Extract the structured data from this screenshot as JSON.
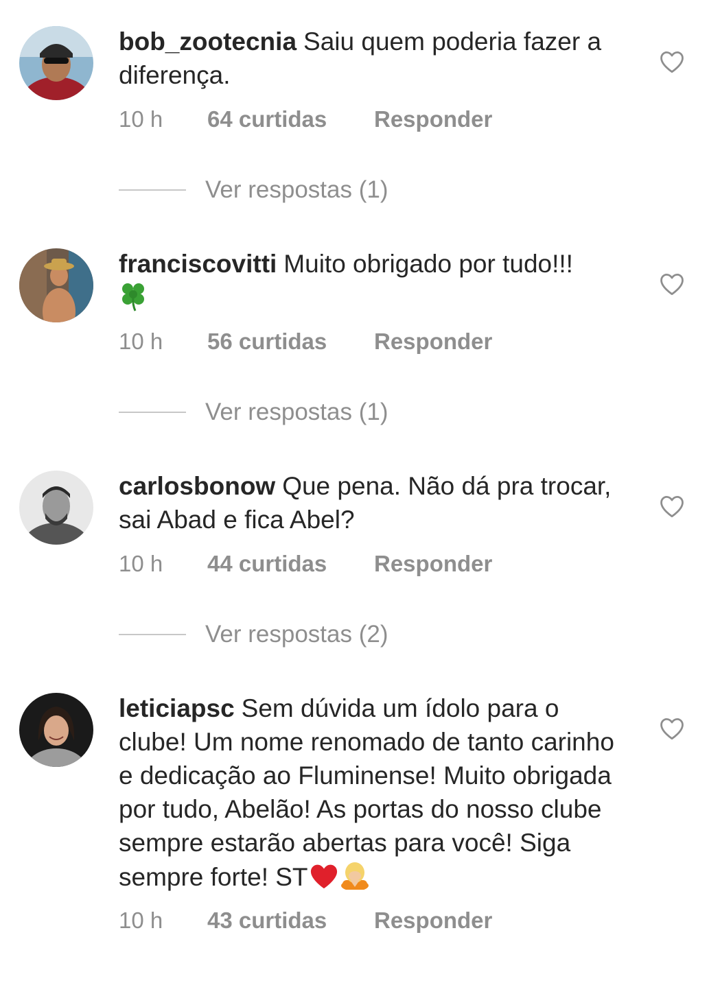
{
  "comments": [
    {
      "username": "bob_zootecnia",
      "text": "Saiu quem poderia fazer a diferença.",
      "time": "10 h",
      "likes": "64 curtidas",
      "reply": "Responder",
      "view_replies": "Ver respostas (1)"
    },
    {
      "username": "franciscovitti",
      "text": "Muito obrigado por tudo!!!",
      "emoji": "four-leaf-clover",
      "time": "10 h",
      "likes": "56 curtidas",
      "reply": "Responder",
      "view_replies": "Ver respostas (1)"
    },
    {
      "username": "carlosbonow",
      "text": "Que pena. Não dá pra trocar, sai Abad e fica Abel?",
      "time": "10 h",
      "likes": "44 curtidas",
      "reply": "Responder",
      "view_replies": "Ver respostas (2)"
    },
    {
      "username": "leticiapsc",
      "text": "Sem dúvida um ídolo para o clube! Um nome renomado de tanto carinho e dedicação ao Fluminense! Muito obrigada por tudo, Abelão! As portas do nosso clube sempre estarão abertas para você! Siga sempre forte! ST",
      "emoji": "red-heart, person-bowing",
      "time": "10 h",
      "likes": "43 curtidas",
      "reply": "Responder"
    }
  ],
  "colors": {
    "text": "#262626",
    "meta": "#8e8e8e",
    "reply_line": "#c7c7c7",
    "heart_outline": "#8e8e8e"
  }
}
